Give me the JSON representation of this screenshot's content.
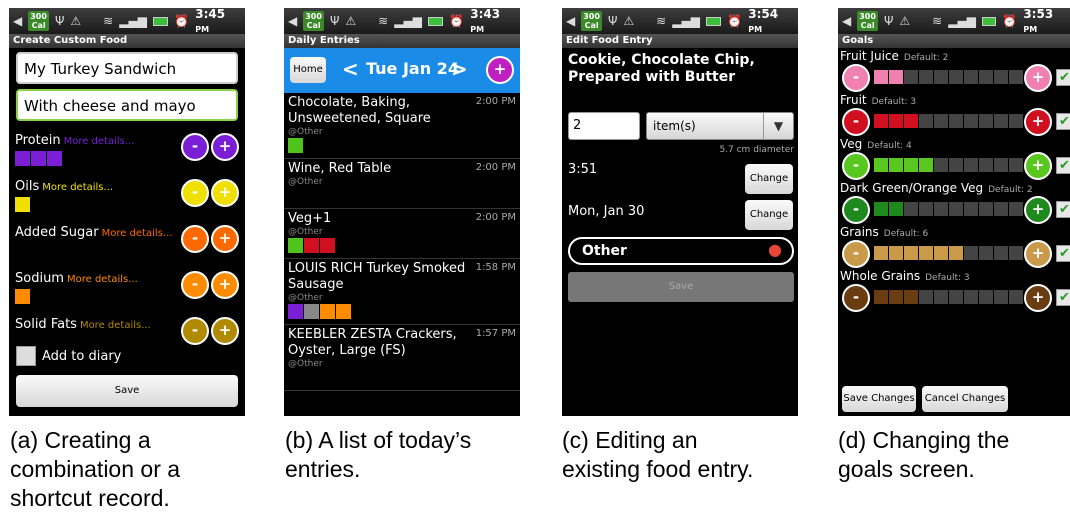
{
  "status_bars": [
    {
      "cal": "300\nCal",
      "time": "3:45",
      "ampm": "PM"
    },
    {
      "cal": "300\nCal",
      "time": "3:43",
      "ampm": "PM"
    },
    {
      "cal": "300\nCal",
      "time": "3:54",
      "ampm": "PM"
    },
    {
      "cal": "300\nCal",
      "time": "3:53",
      "ampm": "PM"
    }
  ],
  "panel_a": {
    "title": "Create Custom Food",
    "name_value": "My Turkey Sandwich",
    "desc_value": "With cheese and mayo",
    "rows": [
      {
        "label": "Protein",
        "more": "More details...",
        "color": "#7a1fd6",
        "filled": 3
      },
      {
        "label": "Oils",
        "more": "More details...",
        "color": "#f0e000",
        "filled": 1
      },
      {
        "label": "Added Sugar",
        "more": "More details...",
        "color": "#ff6a00",
        "filled": 0
      },
      {
        "label": "Sodium",
        "more": "More details...",
        "color": "#ff8c00",
        "filled": 1
      },
      {
        "label": "Solid Fats",
        "more": "More details...",
        "color": "#b08a00",
        "filled": 0
      }
    ],
    "minus": "-",
    "plus": "+",
    "add_to_diary": "Add to diary",
    "save": "Save"
  },
  "panel_b": {
    "title": "Daily Entries",
    "home": "Home",
    "date": "Tue Jan 24",
    "prev": "<",
    "next": ">",
    "add": "+",
    "entries": [
      {
        "name": "Chocolate, Baking, Unsweetened, Square",
        "time": "2:00 PM",
        "tag": "@Other",
        "boxes": [
          "#4fc41f"
        ]
      },
      {
        "name": "Wine, Red Table",
        "time": "2:00 PM",
        "tag": "@Other",
        "boxes": []
      },
      {
        "name": "Veg+1",
        "time": "2:00 PM",
        "tag": "@Other",
        "boxes": [
          "#4fc41f",
          "#d01020",
          "#d01020"
        ]
      },
      {
        "name": "LOUIS RICH Turkey Smoked Sausage",
        "time": "1:58 PM",
        "tag": "@Other",
        "boxes": [
          "#7a1fd6",
          "#888888",
          "#ff8c00",
          "#ff8c00"
        ]
      },
      {
        "name": "KEEBLER ZESTA Crackers, Oyster, Large (FS)",
        "time": "1:57 PM",
        "tag": "@Other",
        "boxes": []
      }
    ]
  },
  "panel_c": {
    "title": "Edit Food Entry",
    "food": "Cookie, Chocolate Chip, Prepared with Butter",
    "quantity": "2",
    "unit": "item(s)",
    "size_note": "5.7 cm diameter",
    "time": "3:51",
    "date": "Mon, Jan 30",
    "change": "Change",
    "location": "Other",
    "save": "Save"
  },
  "panel_d": {
    "title": "Goals",
    "goals": [
      {
        "name": "Fruit Juice",
        "default": "Default: 2",
        "color": "#f080b0",
        "filled": 2
      },
      {
        "name": "Fruit",
        "default": "Default: 3",
        "color": "#d01020",
        "filled": 3
      },
      {
        "name": "Veg",
        "default": "Default: 4",
        "color": "#58c820",
        "filled": 4
      },
      {
        "name": "Dark Green/Orange Veg",
        "default": "Default: 2",
        "color": "#1e8a1e",
        "filled": 2
      },
      {
        "name": "Grains",
        "default": "Default: 6",
        "color": "#c89a4a",
        "filled": 6
      },
      {
        "name": "Whole Grains",
        "default": "Default: 3",
        "color": "#6a3c12",
        "filled": 3
      }
    ],
    "save_changes": "Save Changes",
    "cancel_changes": "Cancel Changes"
  },
  "captions": [
    [
      "(a) Creating a",
      "combination or a",
      "shortcut record."
    ],
    [
      "(b) A list of today’s",
      "entries."
    ],
    [
      "(c) Editing an",
      "existing food entry."
    ],
    [
      "(d) Changing the",
      "goals screen."
    ]
  ]
}
